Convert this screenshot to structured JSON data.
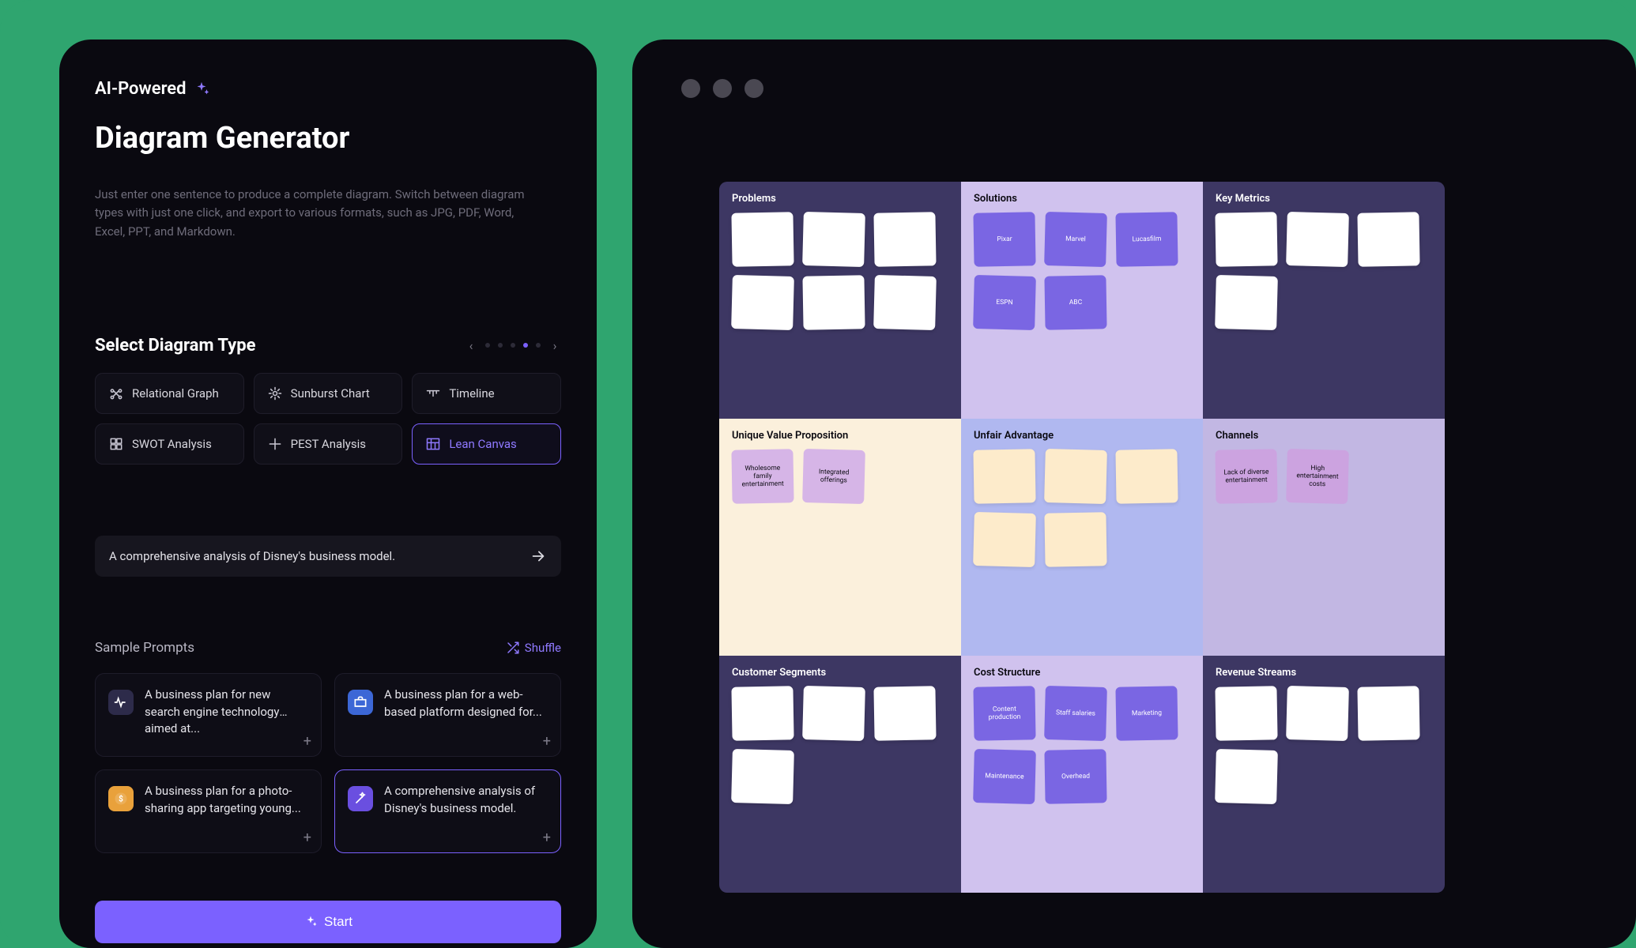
{
  "panel": {
    "badge": "AI-Powered",
    "title": "Diagram Generator",
    "description": "Just enter one sentence to produce a complete diagram. Switch between diagram types with just one click, and export to various formats, such as JPG, PDF, Word, Excel, PPT, and Markdown.",
    "select_label": "Select Diagram Type",
    "pager_active_index": 3,
    "types": [
      {
        "label": "Relational Graph",
        "icon": "graph"
      },
      {
        "label": "Sunburst Chart",
        "icon": "sunburst"
      },
      {
        "label": "Timeline",
        "icon": "timeline"
      },
      {
        "label": "SWOT Analysis",
        "icon": "grid"
      },
      {
        "label": "PEST Analysis",
        "icon": "plus-cross"
      },
      {
        "label": "Lean Canvas",
        "icon": "canvas",
        "selected": true
      }
    ],
    "prompt_value": "A comprehensive analysis of Disney's business model.",
    "sample_header": "Sample Prompts",
    "shuffle_label": "Shuffle",
    "samples": [
      {
        "icon_color": "#2d2b4a",
        "icon_glyph": "pulse",
        "text": "A business plan for new search engine technology aimed at...",
        "selected": false
      },
      {
        "icon_color": "#3c67d6",
        "icon_glyph": "briefcase",
        "text": "A business plan for a web-based platform designed for...",
        "selected": false
      },
      {
        "icon_color": "#e9a13b",
        "icon_glyph": "dollar",
        "text": "A business plan for a photo-sharing app targeting young...",
        "selected": false
      },
      {
        "icon_color": "#6a4fe0",
        "icon_glyph": "wand",
        "text": "A comprehensive analysis of Disney's business model.",
        "selected": true
      }
    ],
    "start_label": "Start"
  },
  "canvas": {
    "cells": [
      {
        "title": "Problems",
        "bg": "dark",
        "note_style": "white",
        "notes": [
          "",
          "",
          "",
          "",
          "",
          ""
        ]
      },
      {
        "title": "Solutions",
        "bg": "lilac",
        "note_style": "purple",
        "notes": [
          "Pixar",
          "Marvel",
          "Lucasfilm",
          "ESPN",
          "ABC"
        ]
      },
      {
        "title": "Key Metrics",
        "bg": "dark",
        "note_style": "white",
        "notes": [
          "",
          "",
          "",
          ""
        ]
      },
      {
        "title": "Unique Value Proposition",
        "bg": "cream",
        "note_style": "pink",
        "notes": [
          "Wholesome family entertainment",
          "Integrated offerings"
        ]
      },
      {
        "title": "Unfair Advantage",
        "bg": "blue",
        "note_style": "cream",
        "notes": [
          "",
          "",
          "",
          "",
          ""
        ]
      },
      {
        "title": "Channels",
        "bg": "mauve",
        "note_style": "pink2",
        "notes": [
          "Lack of diverse entertainment",
          "High entertainment costs"
        ]
      },
      {
        "title": "Customer Segments",
        "bg": "dark",
        "note_style": "white",
        "notes": [
          "",
          "",
          "",
          ""
        ]
      },
      {
        "title": "Cost Structure",
        "bg": "lilac",
        "note_style": "purple",
        "notes": [
          "Content production",
          "Staff salaries",
          "Marketing",
          "Maintenance",
          "Overhead"
        ]
      },
      {
        "title": "Revenue Streams",
        "bg": "dark",
        "note_style": "white",
        "notes": [
          "",
          "",
          "",
          ""
        ]
      }
    ]
  }
}
